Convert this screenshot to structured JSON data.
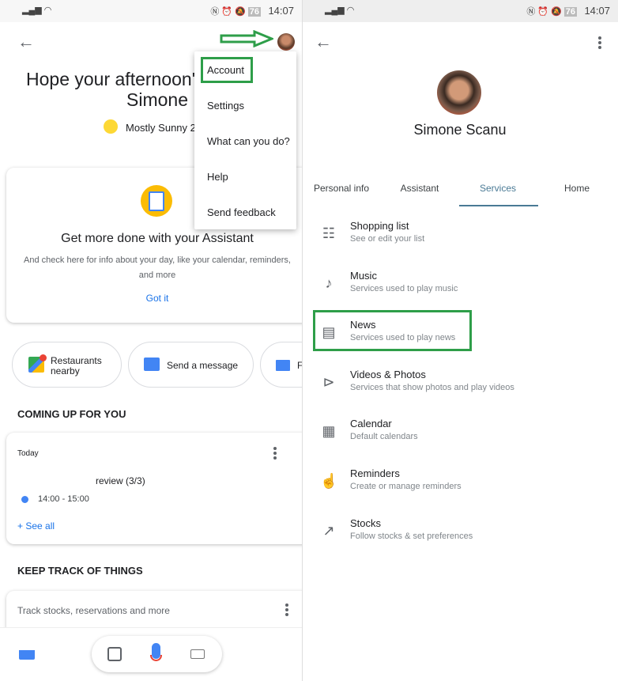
{
  "status_bar": {
    "time": "14:07",
    "battery": "76"
  },
  "left": {
    "greeting_line1": "Hope your afternoon's",
    "greeting_line2": "Simone",
    "weather": "Mostly Sunny 2",
    "menu": [
      "Account",
      "Settings",
      "What can you do?",
      "Help",
      "Send feedback"
    ],
    "assistant_card": {
      "title": "Get more done with your Assistant",
      "body_line1": "And check here for info about your day, like your calendar, reminders,",
      "body_line2": "and more",
      "action": "Got it"
    },
    "chips": [
      {
        "label_line1": "Restaurants",
        "label_line2": "nearby",
        "icon": "maps-icon"
      },
      {
        "label": "Send a message",
        "icon": "message-icon"
      },
      {
        "label": "F",
        "icon": "cake-icon"
      }
    ],
    "coming_up": {
      "header": "COMING UP FOR YOU",
      "day": "Today",
      "event": "review (3/3)",
      "time": "14:00 - 15:00",
      "see_all": "+ See all"
    },
    "keep_track": {
      "header": "KEEP TRACK OF THINGS",
      "text": "Track stocks, reservations and more"
    }
  },
  "right": {
    "name": "Simone Scanu",
    "tabs": [
      "Personal info",
      "Assistant",
      "Services",
      "Home"
    ],
    "active_tab": "Services",
    "services": [
      {
        "title": "Shopping list",
        "subtitle": "See or edit your list",
        "icon": "list-icon"
      },
      {
        "title": "Music",
        "subtitle": "Services used to play music",
        "icon": "music-note-icon"
      },
      {
        "title": "News",
        "subtitle": "Services used to play news",
        "icon": "newspaper-icon"
      },
      {
        "title": "Videos & Photos",
        "subtitle": "Services that show photos and play videos",
        "icon": "video-icon"
      },
      {
        "title": "Calendar",
        "subtitle": "Default calendars",
        "icon": "calendar-icon"
      },
      {
        "title": "Reminders",
        "subtitle": "Create or manage reminders",
        "icon": "reminder-icon"
      },
      {
        "title": "Stocks",
        "subtitle": "Follow stocks & set preferences",
        "icon": "trending-icon"
      }
    ]
  },
  "colors": {
    "highlight": "#2e9e49",
    "link": "#1a73e8",
    "active_tab": "#4a7a95"
  }
}
